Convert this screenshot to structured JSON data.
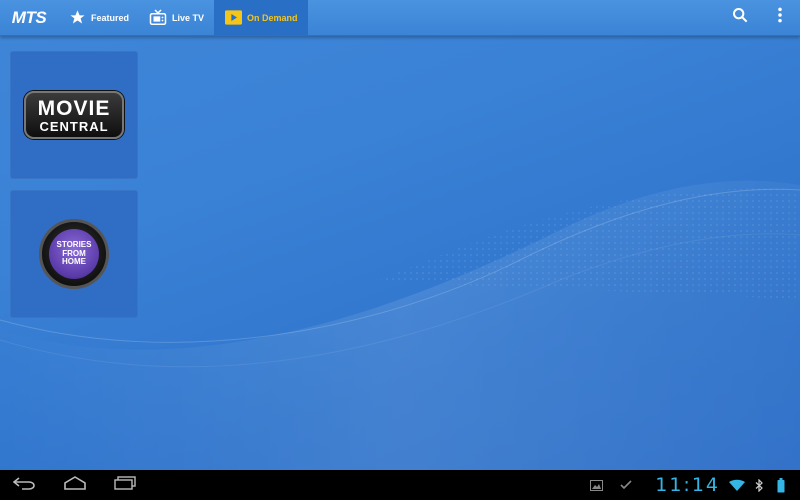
{
  "app": {
    "brand": "MTS"
  },
  "actionbar": {
    "tabs": [
      {
        "label": "Featured",
        "icon": "star-icon"
      },
      {
        "label": "Live TV",
        "icon": "tv-icon"
      },
      {
        "label": "On Demand",
        "icon": "play-icon",
        "active": true
      }
    ],
    "actions": [
      {
        "icon": "search-icon"
      },
      {
        "icon": "overflow-menu-icon"
      }
    ]
  },
  "tiles": [
    {
      "line1": "MOVIE",
      "line2": "CENTRAL"
    },
    {
      "line1": "STORIES",
      "line2": "FROM",
      "line3": "HOME"
    }
  ],
  "systembar": {
    "time": "11:14",
    "status_icons": [
      "gallery-icon",
      "check-icon",
      "wifi-icon",
      "bluetooth-icon",
      "battery-icon"
    ]
  },
  "colors": {
    "accent": "#f5c518",
    "clock": "#33b5e5",
    "background": "#3a82d6"
  }
}
